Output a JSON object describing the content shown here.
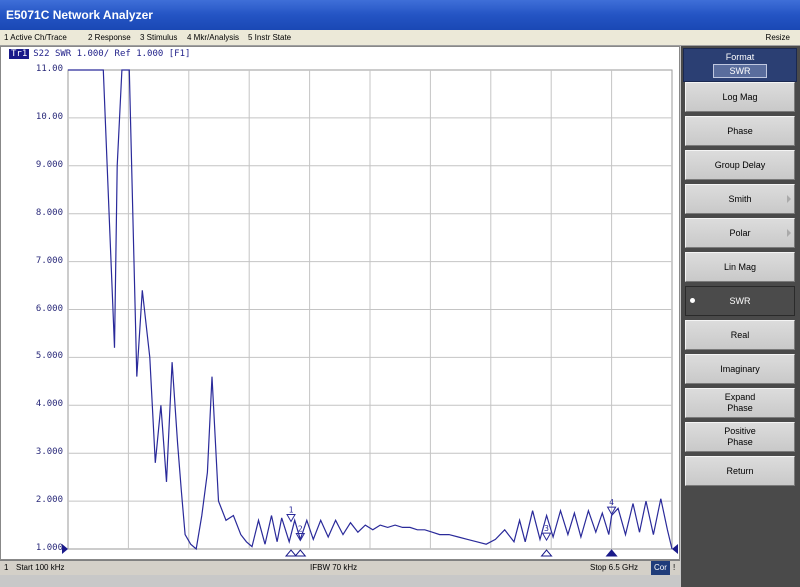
{
  "window": {
    "title": "E5071C Network Analyzer"
  },
  "menu": {
    "items": [
      "1 Active Ch/Trace",
      "2 Response",
      "3 Stimulus",
      "4 Mkr/Analysis",
      "5 Instr State"
    ],
    "resize": "Resize"
  },
  "trace": {
    "id": "Tr1",
    "header": "S22 SWR 1.000/ Ref 1.000 [F1]",
    "color": "#2a2a9a"
  },
  "chart_data": {
    "type": "line",
    "title": "",
    "xlabel": "",
    "ylabel": "",
    "x_unit": "GHz",
    "xlim": [
      0.0001,
      6.5
    ],
    "ylim": [
      1.0,
      11.0
    ],
    "y_ticks": [
      "11.00",
      "10.00",
      "9.000",
      "8.000",
      "7.000",
      "6.000",
      "5.000",
      "4.000",
      "3.000",
      "2.000",
      "1.000"
    ],
    "grid": true,
    "series": [
      {
        "x": [
          0.0001,
          0.38,
          0.5,
          0.53,
          0.58,
          0.66,
          0.74,
          0.8,
          0.88,
          0.94,
          1.0,
          1.06,
          1.12,
          1.18,
          1.22,
          1.26,
          1.32,
          1.38,
          1.44,
          1.5,
          1.55,
          1.62,
          1.7,
          1.78,
          1.86,
          1.92,
          1.98,
          2.05,
          2.12,
          2.19,
          2.25,
          2.3,
          2.38,
          2.44,
          2.5,
          2.57,
          2.64,
          2.72,
          2.8,
          2.88,
          2.96,
          3.04,
          3.12,
          3.2,
          3.28,
          3.36,
          3.44,
          3.52,
          3.6,
          3.68,
          3.76,
          3.84,
          3.92,
          4.0,
          4.1,
          4.2,
          4.3,
          4.4,
          4.5,
          4.6,
          4.7,
          4.8,
          4.86,
          4.92,
          5.0,
          5.08,
          5.15,
          5.22,
          5.3,
          5.38,
          5.45,
          5.52,
          5.6,
          5.68,
          5.75,
          5.82,
          5.85,
          5.92,
          6.0,
          6.08,
          6.15,
          6.22,
          6.3,
          6.38,
          6.45,
          6.5
        ],
        "y": [
          11.0,
          11.0,
          5.2,
          9.0,
          11.0,
          11.0,
          4.6,
          6.4,
          5.0,
          2.8,
          4.0,
          2.4,
          4.9,
          3.2,
          2.2,
          1.3,
          1.1,
          1.0,
          1.7,
          2.6,
          4.6,
          2.0,
          1.6,
          1.7,
          1.3,
          1.15,
          1.05,
          1.6,
          1.1,
          1.7,
          1.15,
          1.65,
          1.15,
          1.6,
          1.2,
          1.6,
          1.2,
          1.6,
          1.25,
          1.6,
          1.3,
          1.55,
          1.35,
          1.5,
          1.4,
          1.5,
          1.45,
          1.5,
          1.45,
          1.45,
          1.4,
          1.4,
          1.35,
          1.3,
          1.3,
          1.25,
          1.2,
          1.15,
          1.1,
          1.2,
          1.4,
          1.15,
          1.6,
          1.15,
          1.8,
          1.2,
          1.7,
          1.25,
          1.8,
          1.3,
          1.75,
          1.25,
          1.8,
          1.35,
          1.75,
          1.3,
          1.7,
          1.85,
          1.3,
          1.95,
          1.35,
          2.0,
          1.3,
          2.05,
          1.4,
          1.0
        ]
      }
    ],
    "markers": [
      {
        "n": "1",
        "label": "1",
        "freq": "2.4000000 GHz",
        "x": 2.4,
        "value": "1.5528",
        "y": 1.5528
      },
      {
        "n": "2",
        "label": "2",
        "freq": "2.5000000 GHz",
        "x": 2.5,
        "value": "1.1570",
        "y": 1.157
      },
      {
        "n": "3",
        "label": "3",
        "freq": "5.1500000 GHz",
        "x": 5.15,
        "value": "1.1655",
        "y": 1.1655
      },
      {
        "n": ">4",
        "label": "4",
        "freq": "5.8500000 GHz",
        "x": 5.85,
        "value": "1.7063",
        "y": 1.7063
      }
    ]
  },
  "status": {
    "channel": "1",
    "start": "Start 100 kHz",
    "ifbw": "IFBW 70 kHz",
    "stop": "Stop 6.5 GHz",
    "cor": "Cor",
    "sep": "!"
  },
  "softkeys": {
    "header": {
      "title": "Format",
      "value": "SWR"
    },
    "buttons": [
      {
        "label": "Log Mag",
        "active": false,
        "submenu": false
      },
      {
        "label": "Phase",
        "active": false,
        "submenu": false
      },
      {
        "label": "Group Delay",
        "active": false,
        "submenu": false
      },
      {
        "label": "Smith",
        "active": false,
        "submenu": true
      },
      {
        "label": "Polar",
        "active": false,
        "submenu": true
      },
      {
        "label": "Lin Mag",
        "active": false,
        "submenu": false
      },
      {
        "label": "SWR",
        "active": true,
        "submenu": false
      },
      {
        "label": "Real",
        "active": false,
        "submenu": false
      },
      {
        "label": "Imaginary",
        "active": false,
        "submenu": false
      },
      {
        "label": "Expand\nPhase",
        "active": false,
        "submenu": false
      },
      {
        "label": "Positive\nPhase",
        "active": false,
        "submenu": false
      },
      {
        "label": "Return",
        "active": false,
        "submenu": false
      }
    ]
  }
}
